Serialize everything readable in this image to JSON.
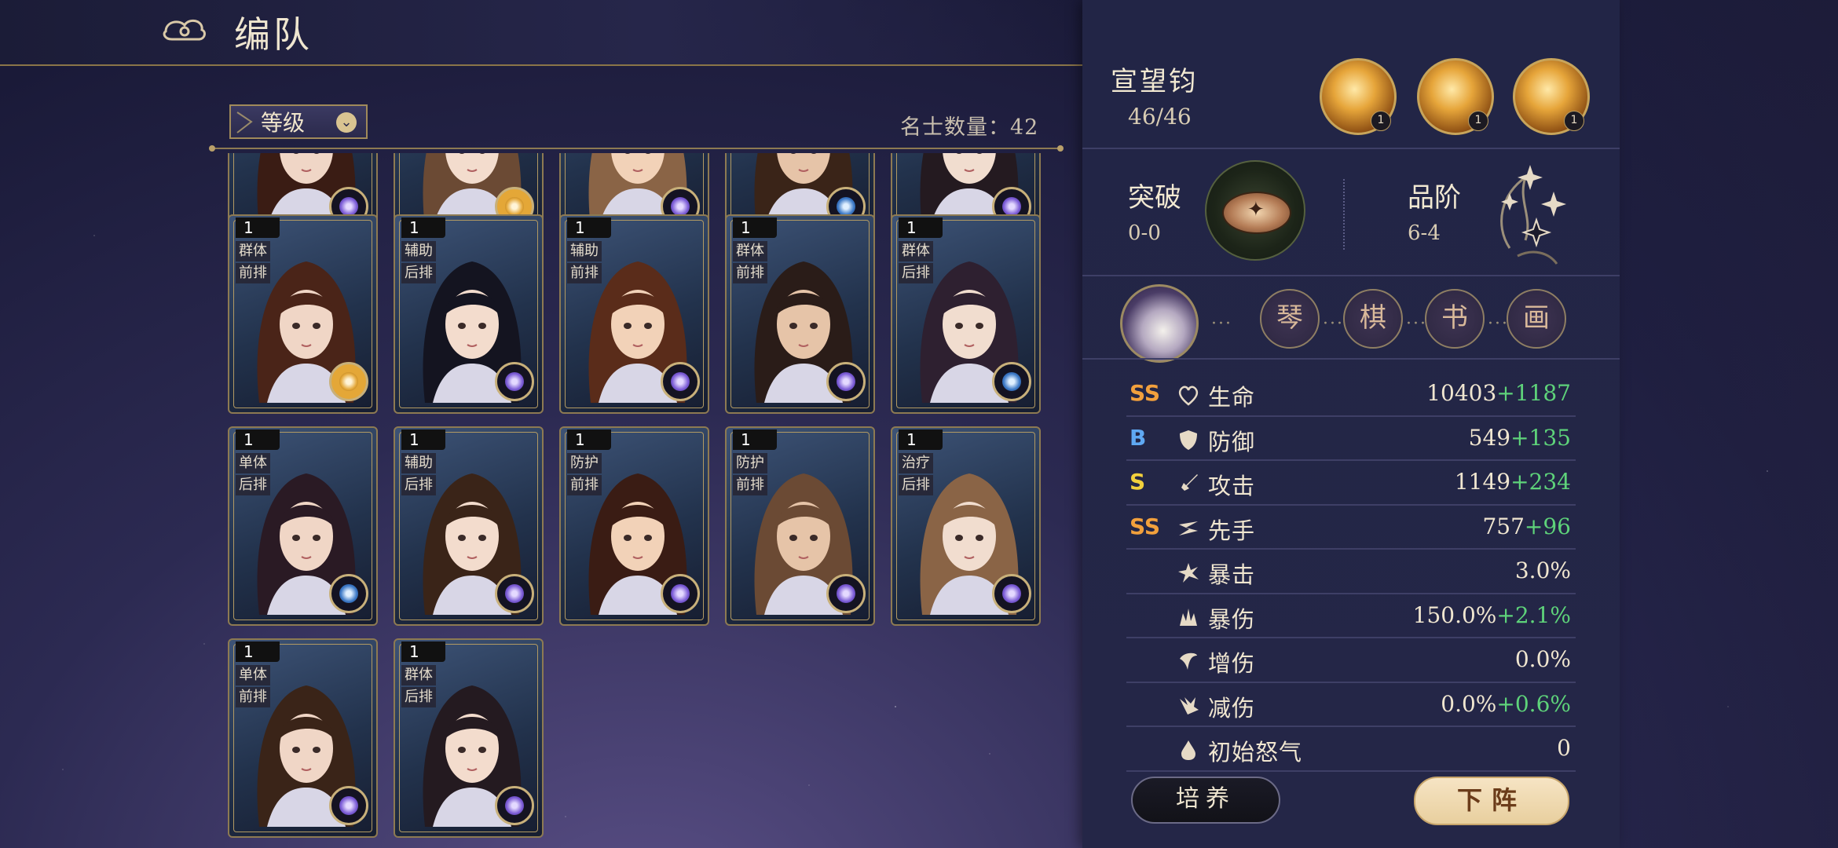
{
  "header": {
    "title": "编队"
  },
  "filter": {
    "label": "等级",
    "count_text": "名士数量：42"
  },
  "roster": [
    {
      "level": "",
      "role": "",
      "position": "",
      "badge": "purple",
      "partial": true
    },
    {
      "level": "",
      "role": "",
      "position": "",
      "badge": "gold",
      "partial": true
    },
    {
      "level": "",
      "role": "",
      "position": "",
      "badge": "purple",
      "partial": true
    },
    {
      "level": "",
      "role": "",
      "position": "",
      "badge": "blue",
      "partial": true
    },
    {
      "level": "",
      "role": "",
      "position": "",
      "badge": "purple",
      "partial": true
    },
    {
      "level": "1",
      "role": "群体",
      "position": "前排",
      "badge": "gold"
    },
    {
      "level": "1",
      "role": "辅助",
      "position": "后排",
      "badge": "purple"
    },
    {
      "level": "1",
      "role": "辅助",
      "position": "前排",
      "badge": "purple"
    },
    {
      "level": "1",
      "role": "群体",
      "position": "前排",
      "badge": "purple"
    },
    {
      "level": "1",
      "role": "群体",
      "position": "后排",
      "badge": "blue"
    },
    {
      "level": "1",
      "role": "单体",
      "position": "后排",
      "badge": "blue"
    },
    {
      "level": "1",
      "role": "辅助",
      "position": "后排",
      "badge": "purple"
    },
    {
      "level": "1",
      "role": "防护",
      "position": "前排",
      "badge": "purple"
    },
    {
      "level": "1",
      "role": "防护",
      "position": "前排",
      "badge": "purple"
    },
    {
      "level": "1",
      "role": "治疗",
      "position": "后排",
      "badge": "purple"
    },
    {
      "level": "1",
      "role": "单体",
      "position": "前排",
      "badge": "purple"
    },
    {
      "level": "1",
      "role": "群体",
      "position": "后排",
      "badge": "purple"
    }
  ],
  "hero": {
    "name": "宣望钧",
    "level": "46/46",
    "skills": [
      {
        "icon": "sword-strike-icon",
        "level": "1"
      },
      {
        "icon": "whirlwind-icon",
        "level": "1"
      },
      {
        "icon": "blade-slash-icon",
        "level": "1"
      }
    ],
    "breakthrough": {
      "label": "突破",
      "value": "0-0"
    },
    "grade": {
      "label": "品阶",
      "value": "6-4"
    },
    "arts": [
      "琴",
      "棋",
      "书",
      "画"
    ]
  },
  "stats": [
    {
      "rank": "SS",
      "rank_class": "ss",
      "icon": "heart-icon",
      "name": "生命",
      "value": "10403",
      "bonus": "+1187"
    },
    {
      "rank": "B",
      "rank_class": "b",
      "icon": "shield-icon",
      "name": "防御",
      "value": "549",
      "bonus": "+135"
    },
    {
      "rank": "S",
      "rank_class": "s",
      "icon": "sword-icon",
      "name": "攻击",
      "value": "1149",
      "bonus": "+234"
    },
    {
      "rank": "SS",
      "rank_class": "ss",
      "icon": "speed-icon",
      "name": "先手",
      "value": "757",
      "bonus": "+96"
    },
    {
      "rank": "",
      "rank_class": "",
      "icon": "crit-icon",
      "name": "暴击",
      "value": "3.0%",
      "bonus": ""
    },
    {
      "rank": "",
      "rank_class": "",
      "icon": "crit-damage-icon",
      "name": "暴伤",
      "value": "150.0%",
      "bonus": "+2.1%"
    },
    {
      "rank": "",
      "rank_class": "",
      "icon": "damage-up-icon",
      "name": "增伤",
      "value": "0.0%",
      "bonus": ""
    },
    {
      "rank": "",
      "rank_class": "",
      "icon": "damage-reduction-icon",
      "name": "减伤",
      "value": "0.0%",
      "bonus": "+0.6%"
    },
    {
      "rank": "",
      "rank_class": "",
      "icon": "rage-drop-icon",
      "name": "初始怒气",
      "value": "0",
      "bonus": ""
    }
  ],
  "buttons": {
    "train": "培养",
    "withdraw": "下阵"
  },
  "colors": {
    "accent_gold": "#c8a55b",
    "bonus_green": "#5ed37a",
    "rank_ss": "#f2a03c",
    "rank_s": "#f2d03c",
    "rank_b": "#5fa8f2"
  }
}
